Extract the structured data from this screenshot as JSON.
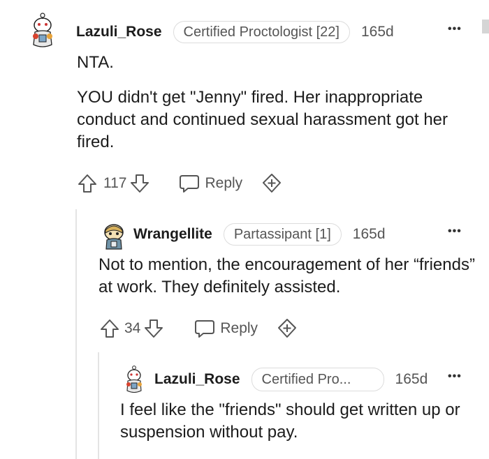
{
  "comments": [
    {
      "username": "Lazuli_Rose",
      "flair": "Certified Proctologist [22]",
      "age": "165d",
      "paragraphs": [
        "NTA.",
        "YOU didn't get \"Jenny\" fired. Her inappropriate conduct and continued sexual harassment got her fired."
      ],
      "votes": "117",
      "reply_label": "Reply"
    },
    {
      "username": "Wrangellite",
      "flair": "Partassipant [1]",
      "age": "165d",
      "paragraphs": [
        "Not to mention, the encouragement of her “friends” at work. They definitely assisted."
      ],
      "votes": "34",
      "reply_label": "Reply"
    },
    {
      "username": "Lazuli_Rose",
      "flair": "Certified Pro...",
      "age": "165d",
      "paragraphs": [
        "I feel like the \"friends\" should get written up or suspension without pay."
      ]
    }
  ],
  "more_label": "•••",
  "icons": {
    "upvote": "upvote-arrow-icon",
    "downvote": "downvote-arrow-icon",
    "reply": "speech-bubble-icon",
    "award": "award-plus-icon"
  },
  "colors": {
    "text": "#1c1c1c",
    "muted": "#555555",
    "border": "#dcdcdc"
  }
}
